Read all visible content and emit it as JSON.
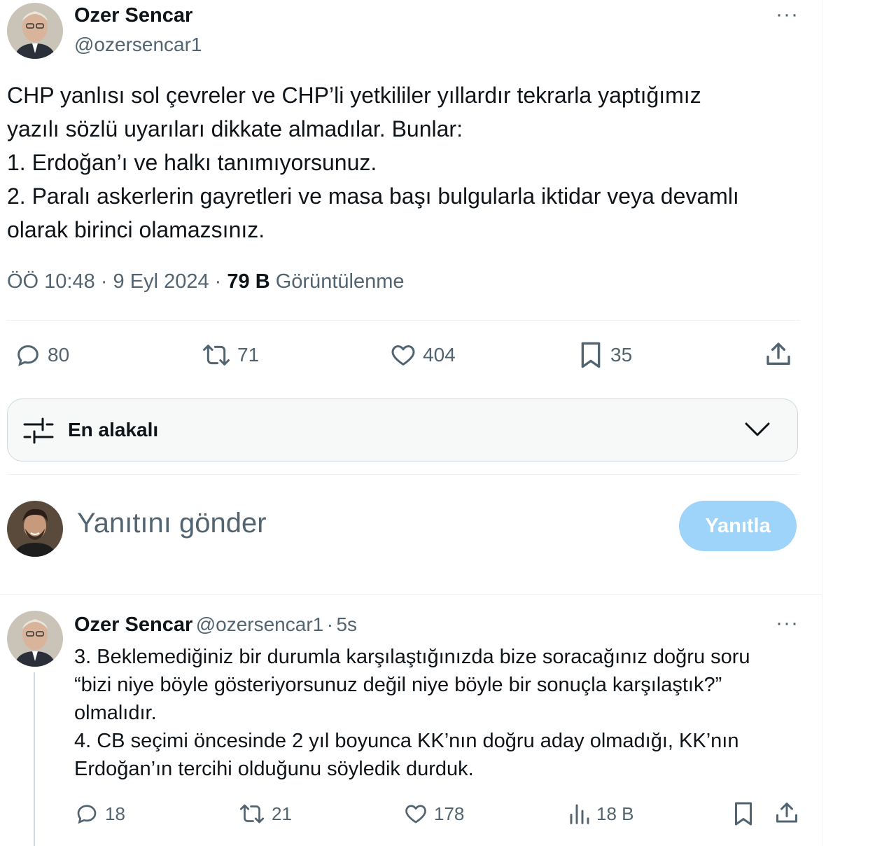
{
  "tweet": {
    "author_name": "Ozer Sencar",
    "author_handle": "@ozersencar1",
    "more_label": "···",
    "text_lines": [
      "CHP yanlısı sol çevreler ve CHP’li yetkililer yıllardır tekrarla yaptığımız",
      "yazılı sözlü uyarıları dikkate almadılar. Bunlar:",
      "1.  Erdoğan’ı ve halkı tanımıyorsunuz.",
      "2. Paralı askerlerin gayretleri ve masa başı bulgularla iktidar veya devamlı",
      "olarak birinci olamazsınız."
    ],
    "time": "ÖÖ 10:48",
    "date": "9 Eyl 2024",
    "separator": "·",
    "views_count": "79 B",
    "views_label": "Görüntülenme",
    "actions": {
      "replies": "80",
      "retweets": "71",
      "likes": "404",
      "bookmarks": "35"
    }
  },
  "sort": {
    "label": "En alakalı"
  },
  "composer": {
    "placeholder": "Yanıtını gönder",
    "button_label": "Yanıtla"
  },
  "reply": {
    "author_name": "Ozer Sencar",
    "author_handle": "@ozersencar1",
    "separator": "·",
    "time": "5s",
    "more_label": "···",
    "text_lines": [
      "3. Beklemediğiniz bir durumla karşılaştığınızda bize soracağınız doğru soru",
      "“bizi niye böyle gösteriyorsunuz değil niye böyle bir sonuçla karşılaştık?”",
      "olmalıdır.",
      "4. CB seçimi öncesinde 2 yıl boyunca KK’nın doğru aday olmadığı, KK’nın",
      "Erdoğan’ın tercihi olduğunu söyledik durduk."
    ],
    "actions": {
      "replies": "18",
      "retweets": "21",
      "likes": "178",
      "views": "18 B"
    }
  },
  "colors": {
    "text": "#0f1419",
    "muted": "#536471",
    "divider": "#eff3f4",
    "reply_button": "#8ecdf8"
  }
}
